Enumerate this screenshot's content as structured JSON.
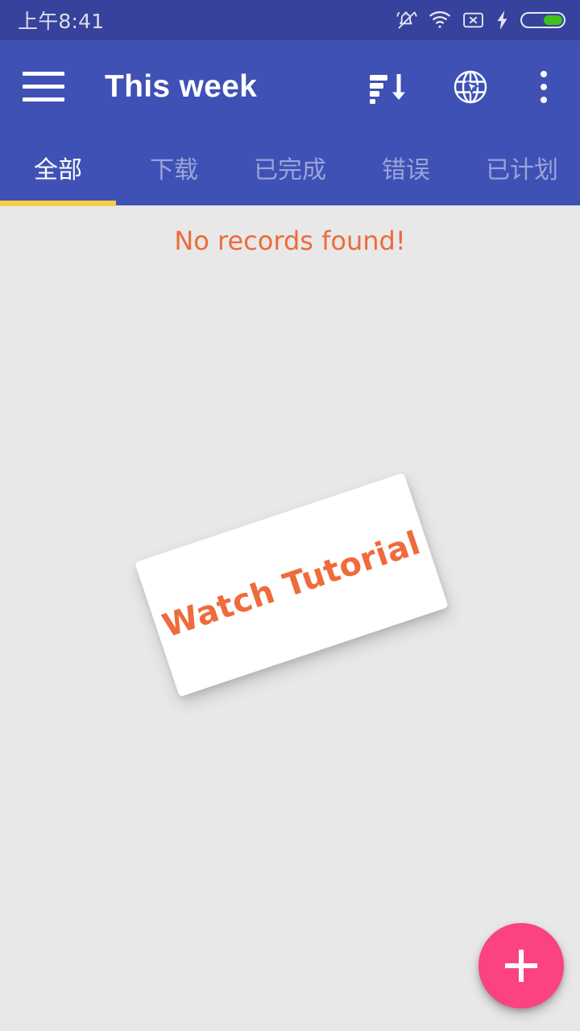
{
  "status_bar": {
    "time": "上午8:41",
    "icons": [
      {
        "name": "vibrate-off-icon"
      },
      {
        "name": "wifi-icon"
      },
      {
        "name": "no-sim-icon"
      },
      {
        "name": "charging-bolt-icon"
      },
      {
        "name": "battery-icon"
      }
    ],
    "background_color": "#36429b",
    "battery_fill_color": "#3ec11f"
  },
  "toolbar": {
    "title": "This week",
    "menu_icon": "hamburger-menu-icon",
    "sort_icon": "sort-descending-icon",
    "browser_icon": "globe-browser-icon",
    "overflow_icon": "overflow-menu-icon",
    "background_color": "#3f51b5"
  },
  "tabs": {
    "items": [
      {
        "label": "全部",
        "active": true
      },
      {
        "label": "下载",
        "active": false
      },
      {
        "label": "已完成",
        "active": false
      },
      {
        "label": "错误",
        "active": false
      },
      {
        "label": "已计划",
        "active": false
      }
    ],
    "indicator_color": "#f5ce4a",
    "active_color": "#ffffff",
    "inactive_color": "#9aa4d8"
  },
  "content": {
    "empty_message": "No records found!",
    "empty_message_color": "#ef6b3b",
    "background_color": "#e8e8e8",
    "tutorial_card": {
      "label": "Watch Tutorial",
      "text_color": "#ef6b3b",
      "background_color": "#ffffff",
      "rotation_degrees": -18.5
    }
  },
  "fab": {
    "icon": "plus-icon",
    "background_color": "#fb4282",
    "icon_color": "#ffffff"
  }
}
